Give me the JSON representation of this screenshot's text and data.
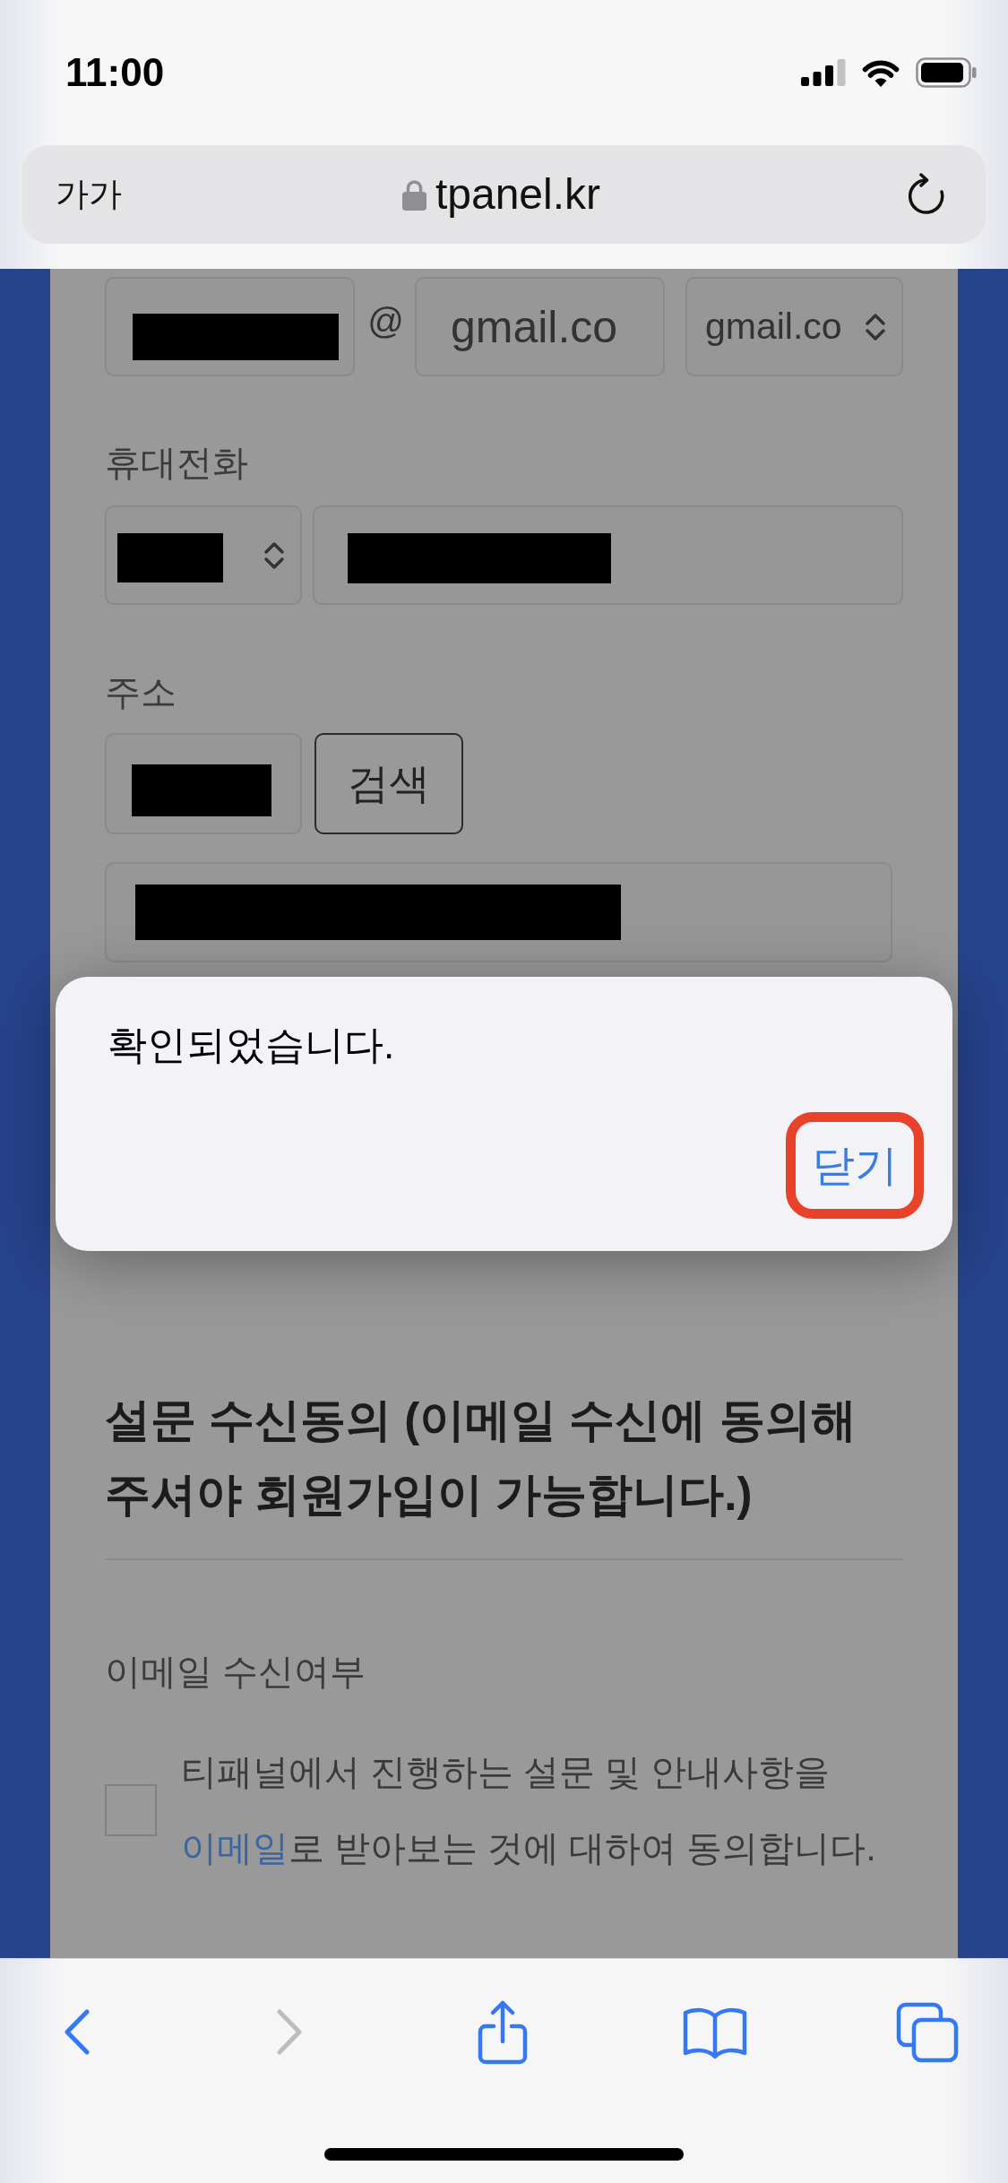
{
  "status_bar": {
    "time": "11:00"
  },
  "address_bar": {
    "text_size_button": "가가",
    "url": "tpanel.kr"
  },
  "form": {
    "email": {
      "local": {
        "redacted": true
      },
      "at_sign": "@",
      "domain": {
        "value": "gmail.co"
      },
      "domain_select": {
        "value": "gmail.co"
      }
    },
    "phone": {
      "label": "휴대전화",
      "prefix_select": {
        "redacted": true
      },
      "number": {
        "redacted": true
      }
    },
    "address": {
      "label": "주소",
      "postcode": {
        "redacted": true
      },
      "search_button": "검색",
      "detail": {
        "redacted": true
      }
    }
  },
  "dialog": {
    "message": "확인되었습니다.",
    "close_button": {
      "label": "닫기",
      "highlighted": true
    }
  },
  "survey": {
    "heading": "설문 수신동의 (이메일 수신에 동의해 주셔야 회원가입이 가능합니다.)",
    "email_consent": {
      "label": "이메일 수신여부",
      "checked": false,
      "text_before": "티패널에서 진행하는 설문 및 안내사항을 ",
      "link": "이메일",
      "text_after": "로 받아보는 것에 대하여 동의합니다."
    }
  },
  "toolbar": {
    "back": {
      "disabled": false
    },
    "forward": {
      "disabled": true
    }
  }
}
